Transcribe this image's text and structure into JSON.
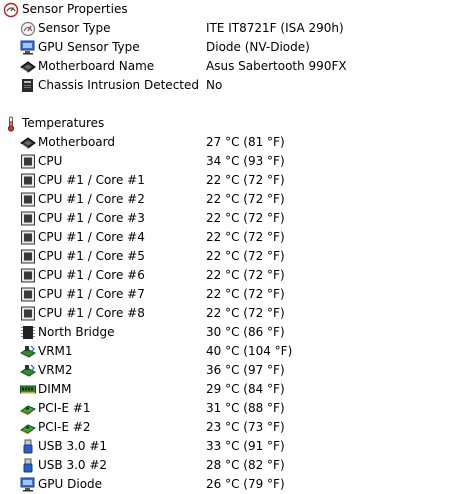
{
  "sections": [
    {
      "title": "Sensor Properties",
      "icon": "sensor-properties-icon",
      "items": [
        {
          "label": "Sensor Type",
          "value": "ITE IT8721F  (ISA 290h)",
          "icon": "sensor-icon"
        },
        {
          "label": "GPU Sensor Type",
          "value": "Diode  (NV-Diode)",
          "icon": "monitor-icon"
        },
        {
          "label": "Motherboard Name",
          "value": "Asus Sabertooth 990FX",
          "icon": "motherboard-icon"
        },
        {
          "label": "Chassis Intrusion Detected",
          "value": "No",
          "icon": "shield-icon"
        }
      ]
    },
    {
      "title": "Temperatures",
      "icon": "thermometer-icon",
      "items": [
        {
          "label": "Motherboard",
          "value": "27 °C  (81 °F)",
          "icon": "motherboard-icon"
        },
        {
          "label": "CPU",
          "value": "34 °C  (93 °F)",
          "icon": "cpu-icon"
        },
        {
          "label": "CPU #1 / Core #1",
          "value": "22 °C  (72 °F)",
          "icon": "cpu-icon"
        },
        {
          "label": "CPU #1 / Core #2",
          "value": "22 °C  (72 °F)",
          "icon": "cpu-icon"
        },
        {
          "label": "CPU #1 / Core #3",
          "value": "22 °C  (72 °F)",
          "icon": "cpu-icon"
        },
        {
          "label": "CPU #1 / Core #4",
          "value": "22 °C  (72 °F)",
          "icon": "cpu-icon"
        },
        {
          "label": "CPU #1 / Core #5",
          "value": "22 °C  (72 °F)",
          "icon": "cpu-icon"
        },
        {
          "label": "CPU #1 / Core #6",
          "value": "22 °C  (72 °F)",
          "icon": "cpu-icon"
        },
        {
          "label": "CPU #1 / Core #7",
          "value": "22 °C  (72 °F)",
          "icon": "cpu-icon"
        },
        {
          "label": "CPU #1 / Core #8",
          "value": "22 °C  (72 °F)",
          "icon": "cpu-icon"
        },
        {
          "label": "North Bridge",
          "value": "30 °C  (86 °F)",
          "icon": "chip-icon"
        },
        {
          "label": "VRM1",
          "value": "40 °C  (104 °F)",
          "icon": "vrm-icon"
        },
        {
          "label": "VRM2",
          "value": "36 °C  (97 °F)",
          "icon": "vrm-icon"
        },
        {
          "label": "DIMM",
          "value": "29 °C  (84 °F)",
          "icon": "memory-icon"
        },
        {
          "label": "PCI-E #1",
          "value": "31 °C  (88 °F)",
          "icon": "pcie-card-icon"
        },
        {
          "label": "PCI-E #2",
          "value": "23 °C  (73 °F)",
          "icon": "pcie-card-icon"
        },
        {
          "label": "USB 3.0 #1",
          "value": "33 °C  (91 °F)",
          "icon": "usb-icon"
        },
        {
          "label": "USB 3.0 #2",
          "value": "28 °C  (82 °F)",
          "icon": "usb-icon"
        },
        {
          "label": "GPU Diode",
          "value": "26 °C  (79 °F)",
          "icon": "monitor-icon"
        }
      ]
    }
  ],
  "colors": {
    "background": "#ffffff",
    "text": "#000000",
    "chip_dark": "#303030",
    "pcb_green": "#2e8b2e",
    "usb_blue": "#2a5fc9",
    "thermometer_red": "#c0392b"
  }
}
